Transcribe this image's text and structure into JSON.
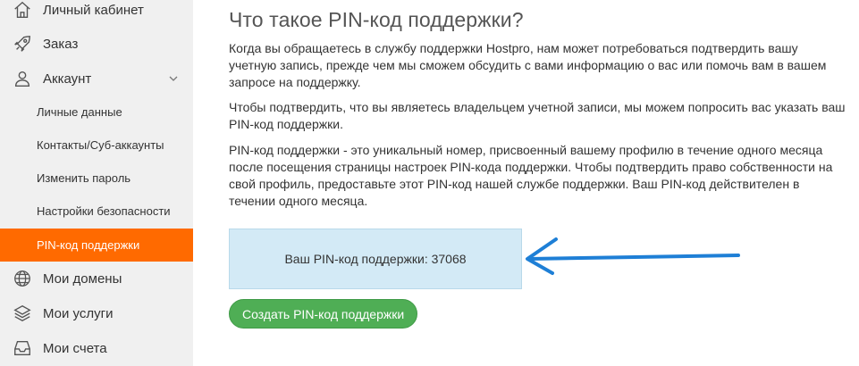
{
  "sidebar": {
    "items": [
      {
        "label": "Личный кабинет",
        "icon": "home-icon"
      },
      {
        "label": "Заказ",
        "icon": "rocket-icon"
      },
      {
        "label": "Аккаунт",
        "icon": "user-icon"
      }
    ],
    "sub_items": [
      {
        "label": "Личные данные"
      },
      {
        "label": "Контакты/Суб-аккаунты"
      },
      {
        "label": "Изменить пароль"
      },
      {
        "label": "Настройки безопасности"
      },
      {
        "label": "PIN-код поддержки",
        "active": true
      }
    ],
    "bottom_items": [
      {
        "label": "Мои домены",
        "icon": "globe-icon"
      },
      {
        "label": "Мои услуги",
        "icon": "layers-icon"
      },
      {
        "label": "Мои счета",
        "icon": "inbox-icon"
      }
    ],
    "active_color": "#ff6a00"
  },
  "main": {
    "title": "Что такое PIN-код поддержки?",
    "paragraphs": [
      "Когда вы обращаетесь в службу поддержки Hostpro, нам может потребоваться подтвердить вашу учетную запись, прежде чем мы сможем обсудить с вами информацию о вас или помочь вам в вашем запросе на поддержку.",
      "Чтобы подтвердить, что вы являетесь владельцем учетной записи, мы можем попросить вас указать ваш PIN-код поддержки.",
      "PIN-код поддержки - это уникальный номер, присвоенный вашему профилю в течение одного месяца после посещения страницы настроек PIN-кода поддержки. Чтобы подтвердить право собственности на свой профиль, предоставьте этот PIN-код нашей службе поддержки. Ваш PIN-код действителен в течении одного месяца."
    ],
    "pin_text": "Ваш PIN-код поддержки: 37068",
    "button_label": "Создать PIN-код поддержки",
    "button_color": "#4fae55",
    "arrow_color": "#1e7fd6"
  }
}
